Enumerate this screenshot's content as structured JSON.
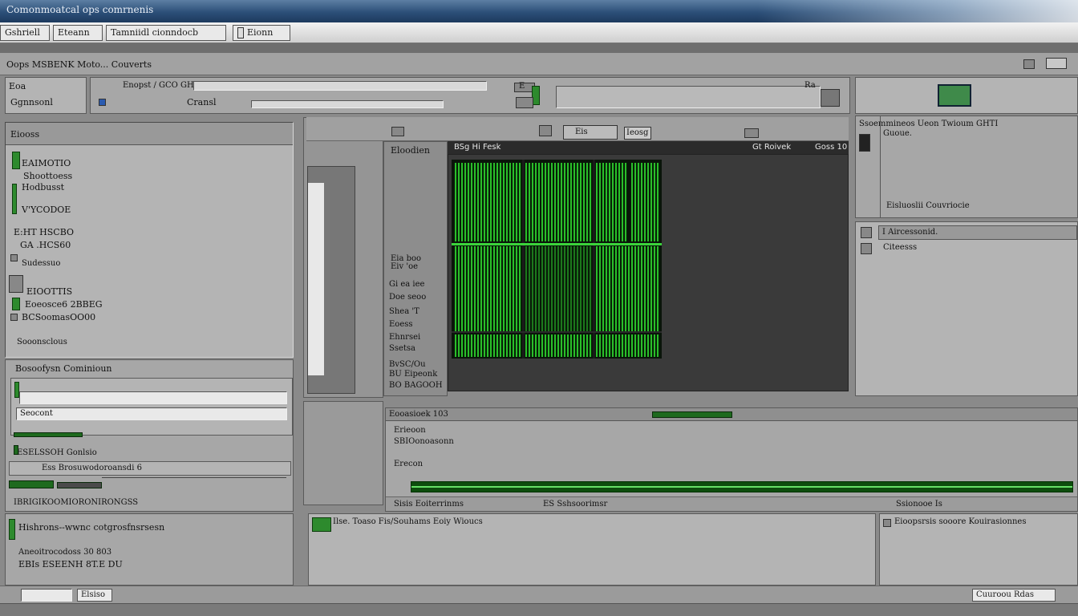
{
  "window": {
    "title": "Comonmoatcal ops comrnenis"
  },
  "toolbar": {
    "buttons": [
      {
        "label": "Gshriell"
      },
      {
        "label": "Eteann"
      },
      {
        "label": "Tamniidl cionndocb"
      },
      {
        "label": "Eionn"
      }
    ]
  },
  "menubar": {
    "path": "Oops MSBENK Moto... Couverts"
  },
  "top_panel": {
    "left_label_1": "Eoa",
    "left_label_2": "Ggnnsonl",
    "field_label": "Enopst / GCO GH",
    "field_value": "Cransl",
    "tag_a": "E",
    "tag_b": "Ra"
  },
  "left_tree": {
    "header": "Eiooss",
    "items": [
      "EAIMOTIO",
      "Shoottoess",
      "Hodbusst",
      "V'YCODOE",
      "E:HT HSCBO",
      "GA .HCS60",
      "Sudessuo",
      "EIOOTTIS",
      "Eoeosce6 2BBEG",
      "BCSoomasOO00",
      "Sooonsclous"
    ]
  },
  "left_lower": {
    "header": "Bosoofysn Cominioun",
    "field_2": "Seocont",
    "label_a": "ESELSSOH Gonlsio",
    "label_b": "Ess Brosuwodoroansdi 6",
    "label_c": "IBRIGIKOOMIORONIRONGSS",
    "label_d": "Hishrons--wwnc cotgrosfnsrsesn",
    "label_e": "Aneoitrocodoss 30 803",
    "label_f": "EBIs ESEENH 8T.E  DU"
  },
  "center_panel": {
    "tab": "Eloodien",
    "side_labels": [
      "Eia boo",
      "Eiv 'oe",
      "Gi ea iee",
      "Doe seoo",
      "Shea 'T",
      "Eoess",
      "Ehnrsei",
      "Ssetsa",
      "BvSC/Ou",
      "BU Eipeonk",
      "BO BAGOOH"
    ],
    "header_left": "BSg  Hi Fesk",
    "header_right_1": "Gt Roivek",
    "header_right_2": "Goss 10",
    "btn_1": "Eis",
    "btn_2": "Ieosg"
  },
  "right_panel": {
    "title": "Ssoemmineos Ueon  Twioum GHTI",
    "sub": "Guoue.",
    "item_1": "Eisluoslii Couvriocie",
    "section": "I Aircessonid.",
    "section_sub": "Citeesss"
  },
  "bottom_center": {
    "bar_label": "Eooasioek 103",
    "line_1": "Erieoon",
    "line_2": "SBIOonoasonn",
    "line_3": "Erecon",
    "status_left": "Sisis Eoiterrinms",
    "status_mid": "ES Sshsoorimsr",
    "status_right": "Ssionooe Is",
    "footer_text": "Ilse. Toaso Fis/Souhams  Eoiy  Wioucs",
    "footer_right": "Eioopsrsis sooore Kouirasionnes"
  },
  "status": {
    "right_button": "Cuuroou Rdas",
    "left_button": "Elsiso"
  }
}
